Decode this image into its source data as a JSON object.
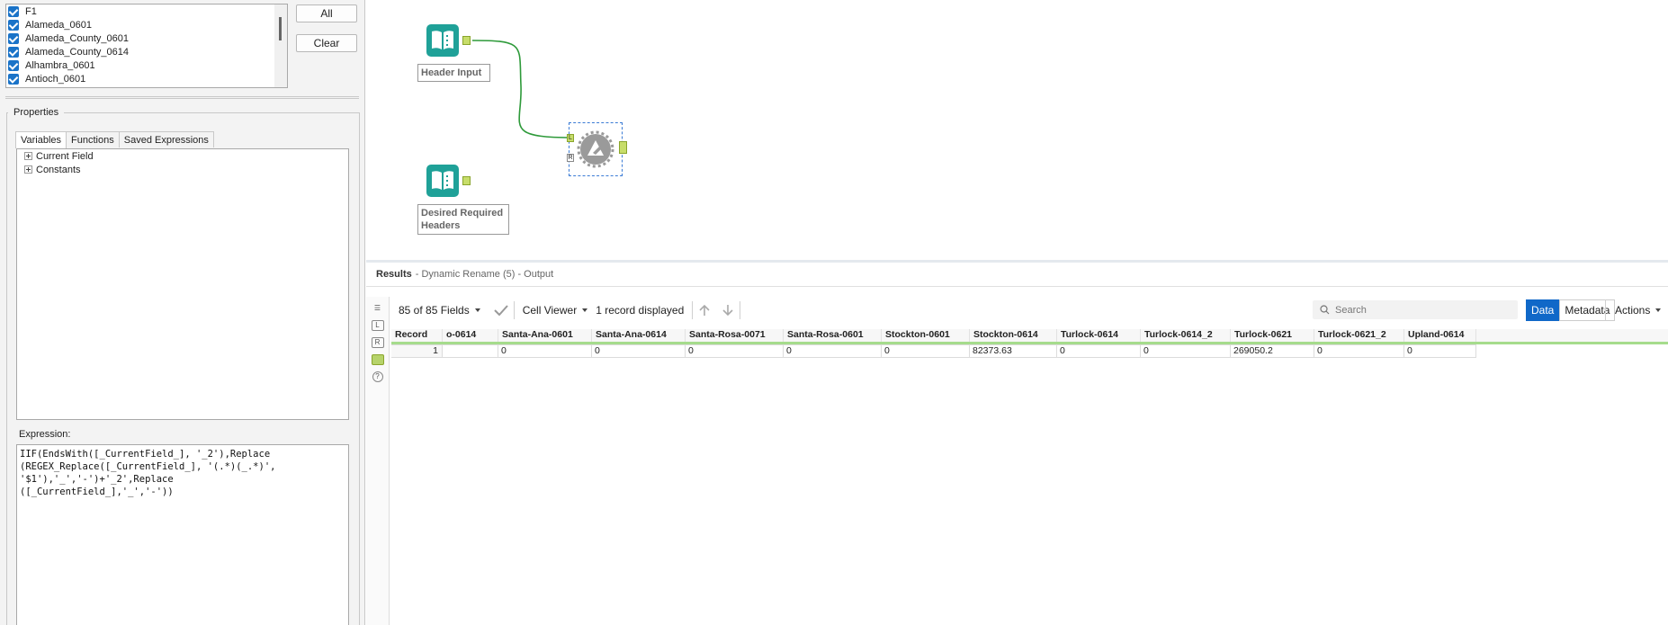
{
  "field_list": {
    "items": [
      "F1",
      "Alameda_0601",
      "Alameda_County_0601",
      "Alameda_County_0614",
      "Alhambra_0601",
      "Antioch_0601"
    ]
  },
  "buttons": {
    "all": "All",
    "clear": "Clear"
  },
  "properties": {
    "title": "Properties",
    "tabs": [
      "Variables",
      "Functions",
      "Saved Expressions"
    ],
    "tree": [
      "Current Field",
      "Constants"
    ],
    "expression_label": "Expression:",
    "expression": "IIF(EndsWith([_CurrentField_], '_2'),Replace\n(REGEX_Replace([_CurrentField_], '(.*)(_.*)',\n'$1'),'_','-')+'_2',Replace\n([_CurrentField_],'_','-'))"
  },
  "canvas": {
    "header_input_label": "Header Input",
    "desired_headers_label": "Desired Required Headers",
    "anchor_l": "L",
    "anchor_r": "R"
  },
  "results": {
    "title": "Results",
    "subtitle": "- Dynamic Rename (5) - Output",
    "fields": "85 of 85 Fields",
    "cell_viewer": "Cell Viewer",
    "records": "1 record displayed",
    "search_placeholder": "Search",
    "data_tab": "Data",
    "metadata_tab": "Metadata",
    "actions": "Actions",
    "columns": [
      "Record",
      "o-0614",
      "Santa-Ana-0601",
      "Santa-Ana-0614",
      "Santa-Rosa-0071",
      "Santa-Rosa-0601",
      "Stockton-0601",
      "Stockton-0614",
      "Turlock-0614",
      "Turlock-0614_2",
      "Turlock-0621",
      "Turlock-0621_2",
      "Upland-0614"
    ],
    "rows": [
      [
        "1",
        "",
        "0",
        "0",
        "0",
        "0",
        "0",
        "82373.63",
        "0",
        "0",
        "269050.2",
        "0",
        "0"
      ]
    ]
  },
  "colors": {
    "accent": "#1068c8",
    "tool_teal": "#1fa198",
    "connector": "#2e9a3a",
    "anchor": "#c7dd6a"
  }
}
